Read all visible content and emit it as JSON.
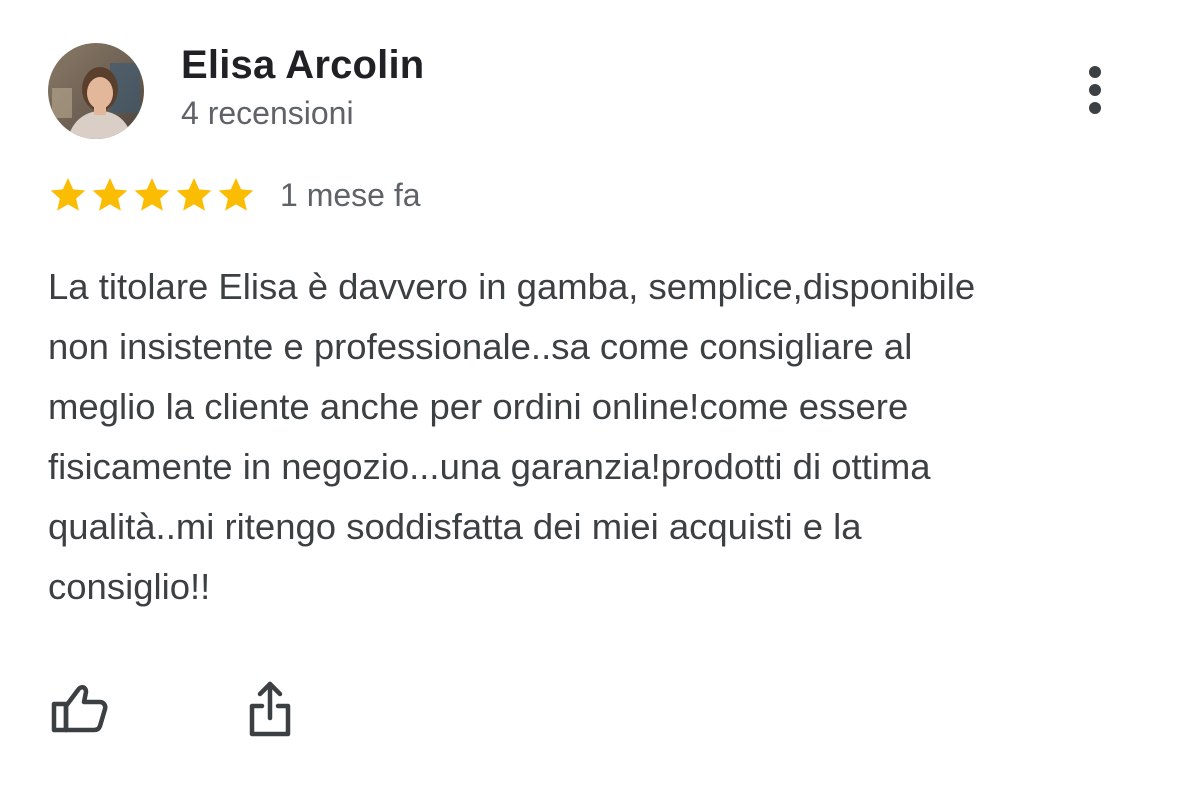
{
  "review": {
    "author_name": "Elisa Arcolin",
    "review_count": "4 recensioni",
    "rating": 5,
    "rating_max": 5,
    "time_ago": "1 mese fa",
    "text_lines": [
      "La titolare Elisa è davvero in gamba, semplice,disponibile",
      "non insistente e professionale..sa come consigliare al",
      "meglio la cliente anche per ordini online!come essere",
      "fisicamente in negozio...una garanzia!prodotti di ottima",
      "qualità..mi ritengo soddisfatta dei miei acquisti e la",
      "consiglio!!"
    ]
  },
  "icons": {
    "avatar": "avatar-photo",
    "more": "more-vert-icon",
    "star": "star-icon",
    "like": "thumb-up-icon",
    "share": "share-icon"
  },
  "colors": {
    "star": "#fbbc04",
    "name": "#202124",
    "secondary": "#5f6368",
    "body": "#3c4043"
  }
}
